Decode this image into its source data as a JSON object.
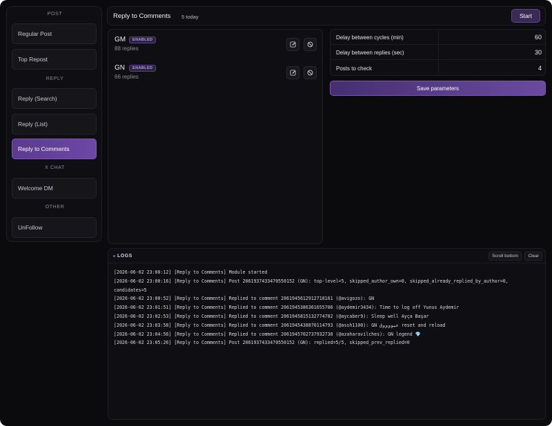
{
  "sidebar": {
    "sections": {
      "post": "POST",
      "reply": "REPLY",
      "x_chat": "X CHAT",
      "other": "OTHER"
    },
    "items": {
      "regular_post": "Regular Post",
      "top_repost": "Top Repost",
      "reply_search": "Reply (Search)",
      "reply_list": "Reply (List)",
      "reply_to_comments": "Reply to Comments",
      "welcome_dm": "Welcome DM",
      "unfollow": "UnFollow"
    },
    "active_item": "Reply to Comments"
  },
  "header": {
    "title": "Reply to Comments",
    "count": "5 today",
    "start_label": "Start"
  },
  "posts": [
    {
      "name": "GM",
      "status": "ENABLED",
      "replies": "88 replies",
      "edit_icon": "pencil-icon",
      "disable_icon": "ban-icon"
    },
    {
      "name": "GN",
      "status": "ENABLED",
      "replies": "66 replies",
      "edit_icon": "pencil-icon",
      "disable_icon": "ban-icon"
    }
  ],
  "params": [
    {
      "label": "Delay between cycles (min)",
      "value": "60"
    },
    {
      "label": "Delay between replies (sec)",
      "value": "30"
    },
    {
      "label": "Posts to check",
      "value": "4"
    }
  ],
  "save_label": "Save parameters",
  "logs": {
    "title": "LOGS",
    "scroll_label": "Scroll bottom",
    "clear_label": "Clear",
    "lines": [
      "[2026-06-02 23:00:12] [Reply to Comments] Module started",
      "[2026-06-02 23:00:16] [Reply to Comments] Post 2061937433470550152 (GN): top-level=5, skipped_author_own=0, skipped_already_replied_by_author=0,",
      "candidates=5",
      "[2026-06-02 23:00:52] [Reply to Comments] Replied to comment 2061945612912718161 (@avigozo): GN",
      "[2026-06-02 23:01:51] [Reply to Comments] Replied to comment 2061945386361655706 (@aydemir3434): Time to log off Yunus Aydemir",
      "[2026-06-02 23:02:53] [Reply to Comments] Replied to comment 2061945815132774782 (@aycaber9): Sleep well Ayça Başar",
      "[2026-06-02 23:03:58] [Reply to Comments] Replied to comment 2061945438870114793 (@assh1100): GN عيووووق reset and reload",
      "[2026-06-02 23:04:56] [Reply to Comments] Replied to comment 2061945702737932738 (@azaharavilches): GN legend 💎",
      "[2026-06-02 23:05:26] [Reply to Comments] Post 2061937433470550152 (GN): replied=5/5, skipped_prev_replied=0"
    ]
  },
  "colors": {
    "background": "#0b0b0e",
    "panel": "#0f0f13",
    "accent": "#6d48a6",
    "badge_text": "#b79be6"
  }
}
